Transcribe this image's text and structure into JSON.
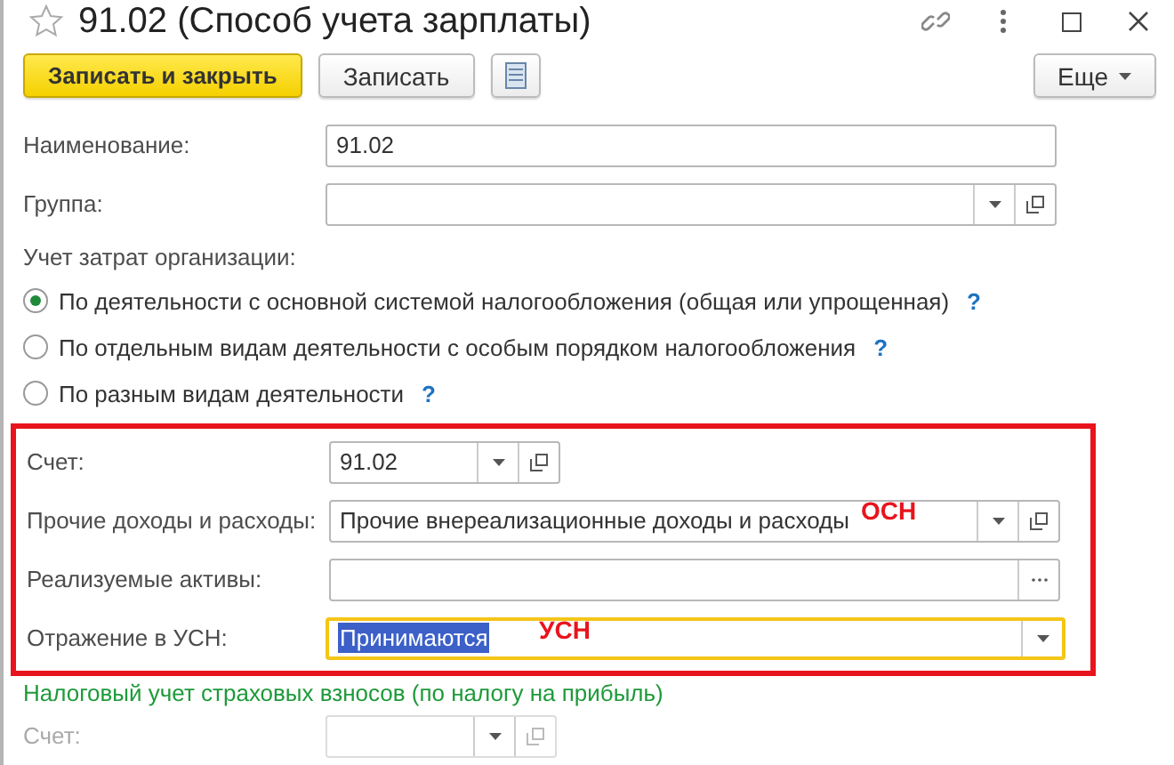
{
  "window": {
    "title": "91.02 (Способ учета зарплаты)",
    "favorite": false
  },
  "toolbar": {
    "buttons": [
      {
        "kind": "primary",
        "label": "Записать и закрыть"
      },
      {
        "kind": "normal",
        "label": "Записать"
      },
      {
        "kind": "icon"
      }
    ],
    "more": "Еще"
  },
  "fields": [
    {
      "label": "Наименование:",
      "kind": "text",
      "value": "91.02"
    },
    {
      "label": "Группа:",
      "kind": "select"
    }
  ],
  "cost_accounting": {
    "label": "Учет затрат организации:",
    "options": [
      {
        "label": "По деятельности с основной системой налогообложения (общая или упрощенная)",
        "help": "?",
        "selected": true
      },
      {
        "label": "По отдельным видам деятельности с особым порядком налогообложения",
        "help": "?",
        "selected": false
      },
      {
        "label": "По разным видам деятельности",
        "help": "?",
        "selected": false
      }
    ]
  },
  "highlighted_fields": [
    {
      "label": "Счет:",
      "kind": "short-select",
      "value": "91.02"
    },
    {
      "label": "Прочие доходы и расходы:",
      "kind": "select",
      "value": "Прочие внереализационные доходы и расходы",
      "annotation": "ОСН"
    },
    {
      "label": "Реализуемые активы:",
      "kind": "choose"
    },
    {
      "label": "Отражение в УСН:",
      "kind": "dropdown",
      "value": "Принимаются",
      "annotation": "УСН",
      "focused": true
    }
  ],
  "insurance_section": {
    "title": "Налоговый учет страховых взносов (по налогу на прибыль)",
    "fields": [
      {
        "label": "Счет:",
        "kind": "short-select",
        "disabled": true
      }
    ]
  }
}
